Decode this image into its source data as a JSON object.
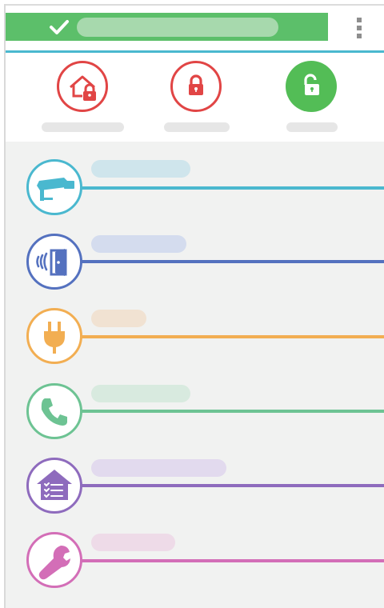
{
  "status": {
    "color": "#5cbf6a",
    "icon": "checkmark-icon",
    "message": ""
  },
  "menu": {
    "icon": "overflow-menu-icon"
  },
  "modes": [
    {
      "id": "home-armed",
      "icon": "house-lock-icon",
      "label": "",
      "state": "outline",
      "color": "#e14545"
    },
    {
      "id": "armed",
      "icon": "lock-icon",
      "label": "",
      "state": "outline",
      "color": "#e14545"
    },
    {
      "id": "disarmed",
      "icon": "unlock-icon",
      "label": "",
      "state": "active",
      "color": "#53bd56"
    }
  ],
  "rows": [
    {
      "id": "cameras",
      "icon": "security-camera-icon",
      "label": "",
      "color": "#4ab8cf",
      "pill_color": "#cfe5ec"
    },
    {
      "id": "door-sensors",
      "icon": "door-sensor-icon",
      "label": "",
      "color": "#5471bf",
      "pill_color": "#d4dcee"
    },
    {
      "id": "smart-plugs",
      "icon": "power-plug-icon",
      "label": "",
      "color": "#f2ae52",
      "pill_color": "#f1e2d2"
    },
    {
      "id": "phone-contacts",
      "icon": "phone-icon",
      "label": "",
      "color": "#6dc393",
      "pill_color": "#d8eadf"
    },
    {
      "id": "home-checklist",
      "icon": "house-checklist-icon",
      "label": "",
      "color": "#8e6bbd",
      "pill_color": "#e2daee"
    },
    {
      "id": "settings",
      "icon": "wrench-icon",
      "label": "",
      "color": "#d36eb7",
      "pill_color": "#eedbe8"
    }
  ]
}
